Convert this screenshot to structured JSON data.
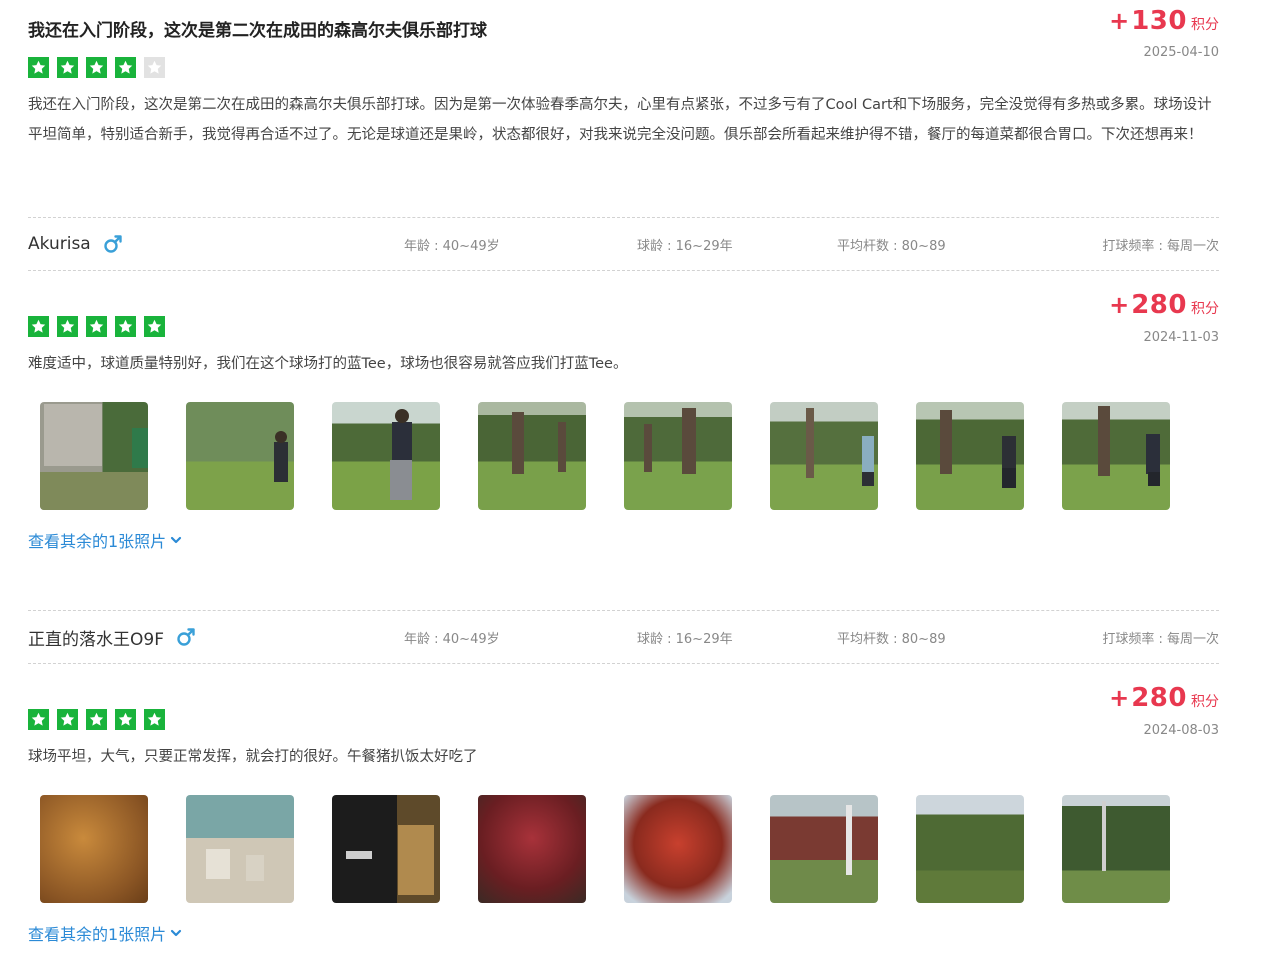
{
  "reviews": [
    {
      "title": "我还在入门阶段，这次是第二次在成田的森高尔夫俱乐部打球",
      "points": {
        "plus": "+",
        "value": "130",
        "unit": "积分"
      },
      "date": "2025-04-10",
      "rating": 4,
      "body": "我还在入门阶段，这次是第二次在成田的森高尔夫俱乐部打球。因为是第一次体验春季高尔夫，心里有点紧张，不过多亏有了Cool Cart和下场服务，完全没觉得有多热或多累。球场设计平坦简单，特别适合新手，我觉得再合适不过了。无论是球道还是果岭，状态都很好，对我来说完全没问题。俱乐部会所看起来维护得不错，餐厅的每道菜都很合胃口。下次还想再来！"
    },
    {
      "user": {
        "name": "Akurisa",
        "age": "年龄 : 40~49岁",
        "experience": "球龄 : 16~29年",
        "avg_score": "平均杆数 : 80~89",
        "frequency": "打球频率 : 每周一次"
      },
      "points": {
        "plus": "+",
        "value": "280",
        "unit": "积分"
      },
      "date": "2024-11-03",
      "rating": 5,
      "body": "难度适中，球道质量特别好，我们在这个球场打的蓝Tee，球场也很容易就答应我们打蓝Tee。",
      "photos": [
        "yardage-sign-photo",
        "golfer-swing-photo",
        "golfer-swing-photo",
        "trees-fairway-photo",
        "trees-fairway-photo",
        "golfer-swing-photo",
        "golfer-address-photo",
        "golfer-swing-photo"
      ],
      "more_photos": "查看其余的1张照片"
    },
    {
      "user": {
        "name": "正直的落水王O9F",
        "age": "年龄 : 40~49岁",
        "experience": "球龄 : 16~29年",
        "avg_score": "平均杆数 : 80~89",
        "frequency": "打球频率 : 每周一次"
      },
      "points": {
        "plus": "+",
        "value": "280",
        "unit": "积分"
      },
      "date": "2024-08-03",
      "rating": 5,
      "body": "球场平坦，大气，只要正常发挥，就会打的很好。午餐猪扒饭太好吃了",
      "photos": [
        "pork-cutlet-photo",
        "restaurant-photo",
        "clubhouse-interior-photo",
        "red-maple-photo",
        "red-maple-photo",
        "autumn-trees-photo",
        "forest-photo",
        "forest-photo"
      ],
      "more_photos": "查看其余的1张照片"
    }
  ],
  "colors": {
    "accent_red": "#e8384f",
    "star_green": "#19b33b",
    "link_blue": "#2b8ad6",
    "male_blue": "#3aa0d8"
  }
}
